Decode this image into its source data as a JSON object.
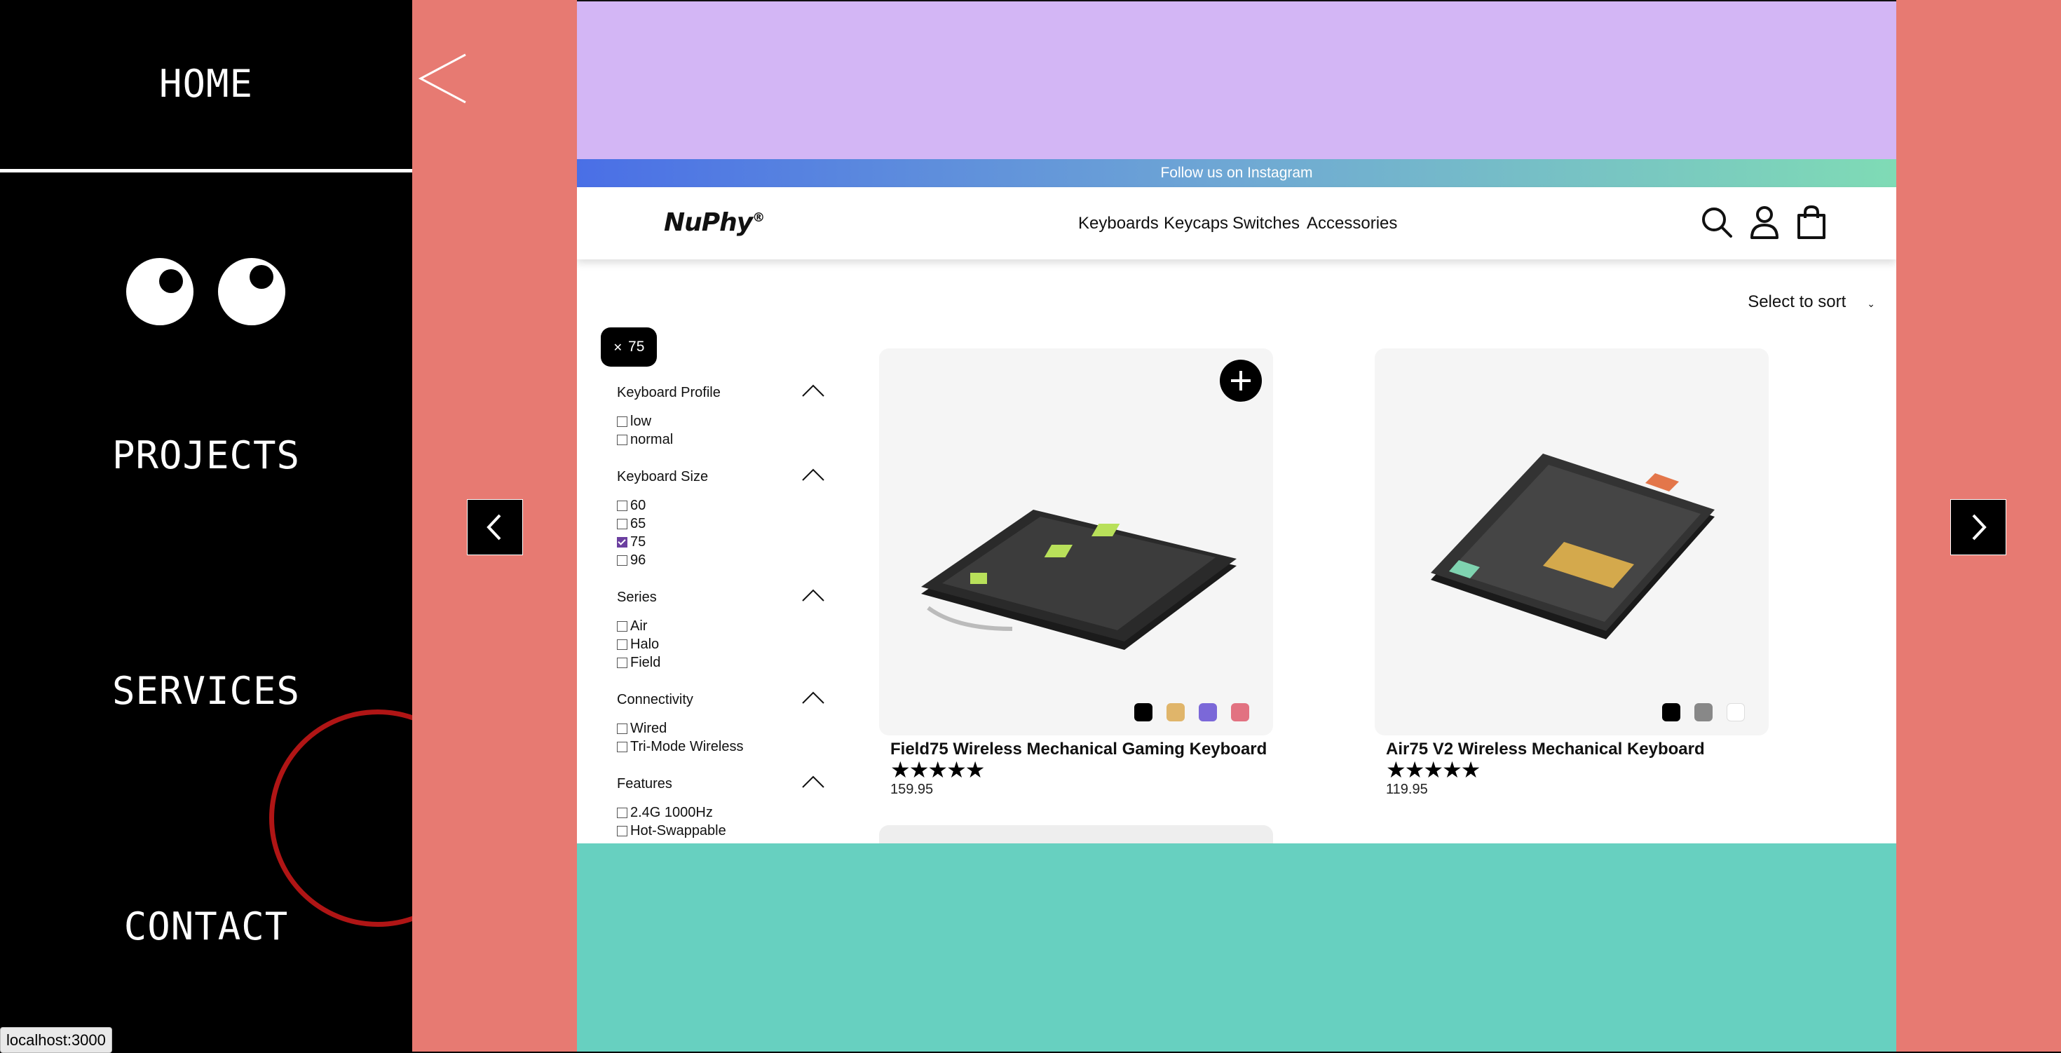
{
  "sidebar": {
    "home": "HOME",
    "projects": "PROJECTS",
    "services": "SERVICES",
    "contact": "CONTACT"
  },
  "site": {
    "announcement": "Follow us on Instagram",
    "logo": "NuPhy",
    "logo_mark": "®",
    "menu": [
      "Keyboards",
      "Keycaps",
      "Switches",
      "Accessories"
    ],
    "sort_label": "Select to sort",
    "active_filter": "75"
  },
  "filters": [
    {
      "title": "Keyboard Profile",
      "options": [
        {
          "label": "low",
          "checked": false
        },
        {
          "label": "normal",
          "checked": false
        }
      ]
    },
    {
      "title": "Keyboard Size",
      "options": [
        {
          "label": "60",
          "checked": false
        },
        {
          "label": "65",
          "checked": false
        },
        {
          "label": "75",
          "checked": true
        },
        {
          "label": "96",
          "checked": false
        }
      ]
    },
    {
      "title": "Series",
      "options": [
        {
          "label": "Air",
          "checked": false
        },
        {
          "label": "Halo",
          "checked": false
        },
        {
          "label": "Field",
          "checked": false
        }
      ]
    },
    {
      "title": "Connectivity",
      "options": [
        {
          "label": "Wired",
          "checked": false
        },
        {
          "label": "Tri-Mode Wireless",
          "checked": false
        }
      ]
    },
    {
      "title": "Features",
      "options": [
        {
          "label": "2.4G 1000Hz",
          "checked": false
        },
        {
          "label": "Hot-Swappable",
          "checked": false
        }
      ]
    }
  ],
  "products": [
    {
      "name": "Field75 Wireless Mechanical Gaming Keyboard",
      "stars": "★★★★★",
      "price": "159.95",
      "swatches": [
        "#000000",
        "#e0b56a",
        "#7b68d8",
        "#e27281"
      ]
    },
    {
      "name": "Air75 V2 Wireless Mechanical Keyboard",
      "stars": "★★★★★",
      "price": "119.95",
      "swatches": [
        "#000000",
        "#888888",
        "#ffffff"
      ]
    }
  ],
  "status_url": "localhost:3000",
  "colors": {
    "salmon": "#e77a72",
    "purple": "#d3b6f5",
    "teal": "#67d0c0",
    "check": "#6b3fa0"
  }
}
